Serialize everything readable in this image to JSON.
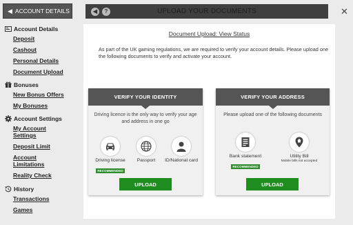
{
  "sidebar": {
    "account_button": "ACCOUNT DETAILS",
    "sections": [
      {
        "title": "Account Details",
        "icon": "id-card-icon",
        "items": [
          "Deposit",
          "Cashout",
          "Personal Details",
          "Document Upload"
        ]
      },
      {
        "title": "Bonuses",
        "icon": "gift-icon",
        "items": [
          "New Bonus Offers",
          "My Bonuses"
        ]
      },
      {
        "title": "Account Settings",
        "icon": "gear-icon",
        "items": [
          "My Account Settings",
          "Deposit Limit",
          "Account Limitations",
          "Reality Check"
        ]
      },
      {
        "title": "History",
        "icon": "history-icon",
        "items": [
          "Transactions",
          "Games"
        ]
      }
    ]
  },
  "topbar": {
    "title": "UPLOAD YOUR DOCUMENTS"
  },
  "panel": {
    "status_link": "Document Upload: View Status",
    "intro": "As part of the UK gaming regulations, we are required to verify your account details. Please upload one the following documents to verify and activate your account.",
    "identity": {
      "header": "VERIFY YOUR IDENTITY",
      "description": "Driving licence is the only way to verify your age and address in one go",
      "options": [
        {
          "label": "Driving license",
          "badge": "RECOMMENDED",
          "icon": "car-icon"
        },
        {
          "label": "Passport",
          "icon": "globe-icon"
        },
        {
          "label": "ID/National card",
          "icon": "person-icon"
        }
      ],
      "button": "UPLOAD"
    },
    "address": {
      "header": "VERIFY YOUR ADDRESS",
      "description": "Please upload one of the following documents",
      "options": [
        {
          "label": "Bank statement",
          "badge": "RECOMMENDED",
          "icon": "bank-statement-icon"
        },
        {
          "label": "Utility Bill",
          "note": "Mobile bills not accepted",
          "icon": "location-pin-icon"
        }
      ],
      "button": "UPLOAD"
    }
  },
  "colors": {
    "accent_green": "#1e8c1e",
    "header_dark": "#555555",
    "topbar": "#3f3f3f"
  }
}
